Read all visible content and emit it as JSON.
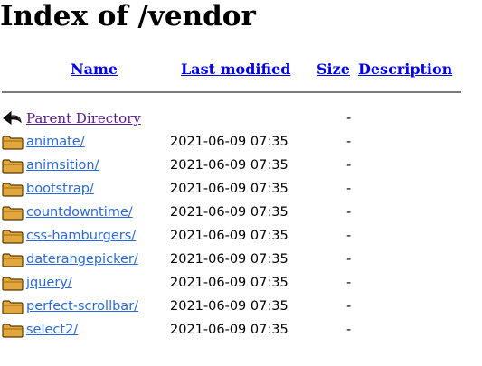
{
  "page": {
    "title": "Index of /vendor"
  },
  "columns": {
    "name": "Name",
    "last_modified": "Last modified",
    "size": "Size",
    "description": "Description"
  },
  "parent": {
    "label": "Parent Directory",
    "size": "-",
    "icon": "back-arrow-icon"
  },
  "entries": [
    {
      "name": "animate/",
      "modified": "2021-06-09 07:35",
      "size": "-",
      "icon": "folder-icon"
    },
    {
      "name": "animsition/",
      "modified": "2021-06-09 07:35",
      "size": "-",
      "icon": "folder-icon"
    },
    {
      "name": "bootstrap/",
      "modified": "2021-06-09 07:35",
      "size": "-",
      "icon": "folder-icon"
    },
    {
      "name": "countdowntime/",
      "modified": "2021-06-09 07:35",
      "size": "-",
      "icon": "folder-icon"
    },
    {
      "name": "css-hamburgers/",
      "modified": "2021-06-09 07:35",
      "size": "-",
      "icon": "folder-icon"
    },
    {
      "name": "daterangepicker/",
      "modified": "2021-06-09 07:35",
      "size": "-",
      "icon": "folder-icon"
    },
    {
      "name": "jquery/",
      "modified": "2021-06-09 07:35",
      "size": "-",
      "icon": "folder-icon"
    },
    {
      "name": "perfect-scrollbar/",
      "modified": "2021-06-09 07:35",
      "size": "-",
      "icon": "folder-icon"
    },
    {
      "name": "select2/",
      "modified": "2021-06-09 07:35",
      "size": "-",
      "icon": "folder-icon"
    }
  ],
  "colors": {
    "link": "#0000ee",
    "visited": "#551a8b",
    "folder_fill": "#d9a441",
    "folder_stroke": "#5a3a00"
  }
}
